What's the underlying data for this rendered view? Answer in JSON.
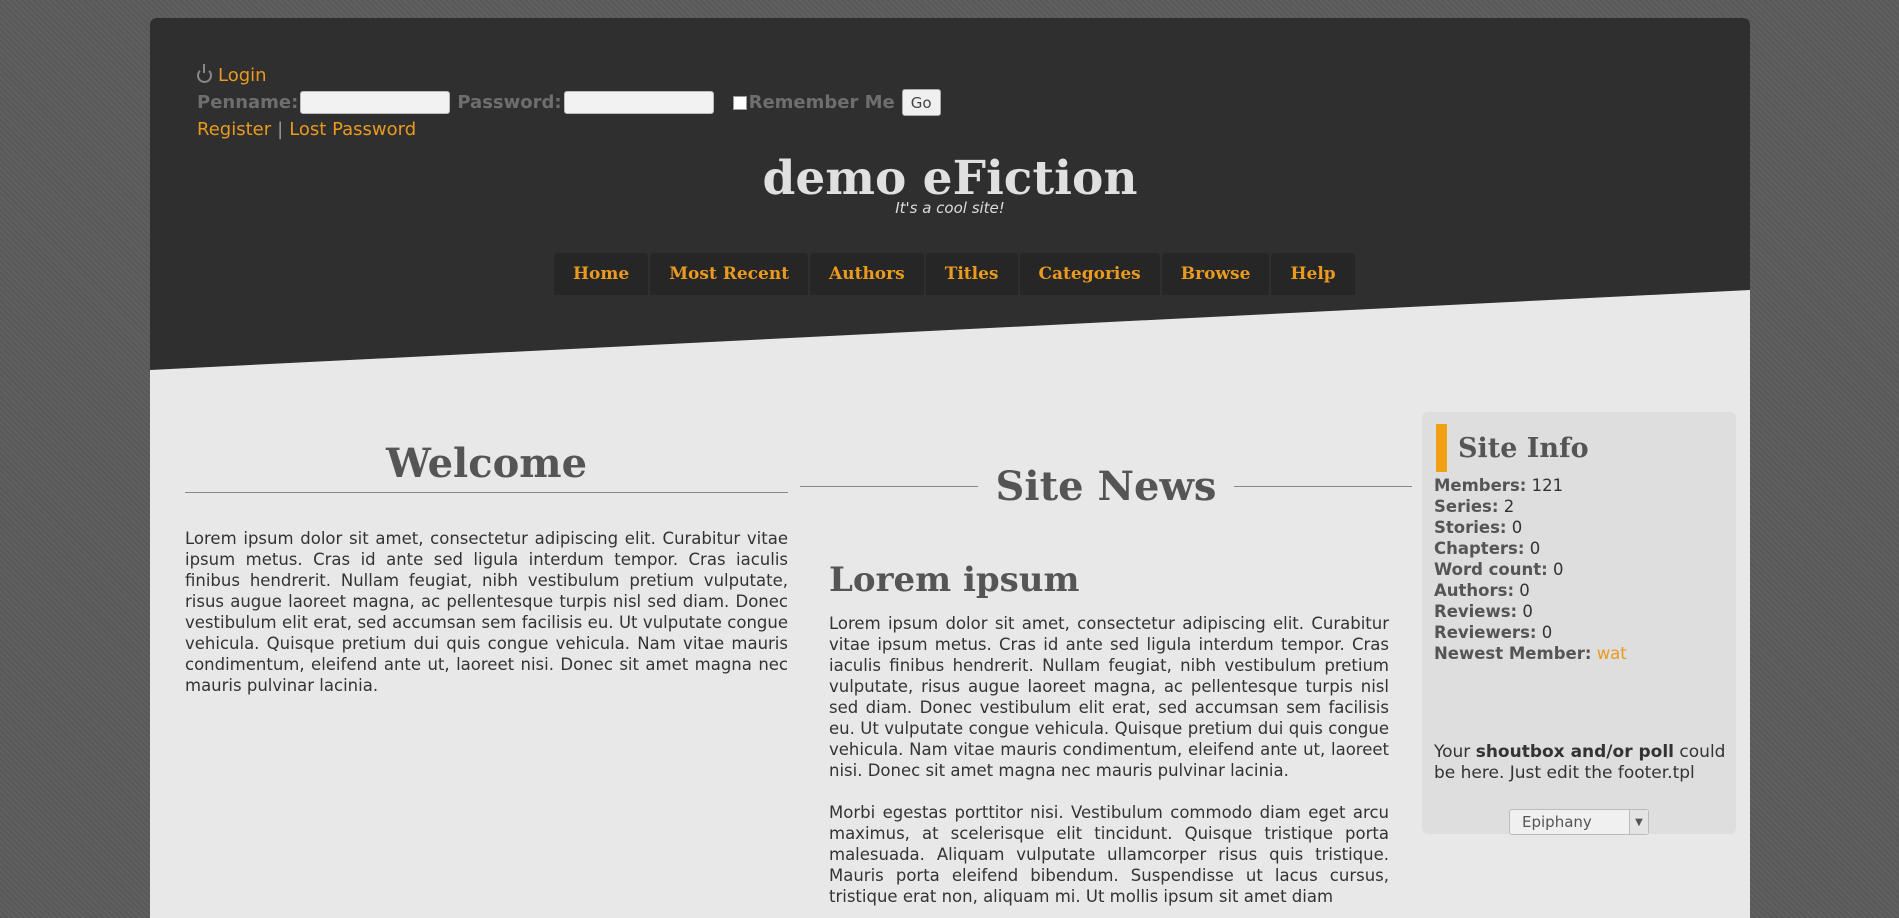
{
  "login": {
    "login_link": "Login",
    "penname_label": "Penname:",
    "password_label": "Password:",
    "remember_label": "Remember Me",
    "go_button": "Go",
    "register_link": "Register",
    "separator": "|",
    "lost_password_link": "Lost Password"
  },
  "site": {
    "title": "demo eFiction",
    "slogan": "It's a cool site!"
  },
  "nav": {
    "items": [
      "Home",
      "Most Recent",
      "Authors",
      "Titles",
      "Categories",
      "Browse",
      "Help"
    ]
  },
  "welcome": {
    "title": "Welcome",
    "text": "Lorem ipsum dolor sit amet, consectetur adipiscing elit. Curabitur vitae ipsum metus. Cras id ante sed ligula interdum tempor. Cras iaculis finibus hendrerit. Nullam feugiat, nibh vestibulum pretium vulputate, risus augue laoreet magna, ac pellentesque turpis nisl sed diam. Donec vestibulum elit erat, sed accumsan sem facilisis eu. Ut vulputate congue vehicula. Quisque pretium dui quis congue vehicula. Nam vitae mauris condimentum, eleifend ante ut, laoreet nisi. Donec sit amet magna nec mauris pulvinar lacinia."
  },
  "news": {
    "title": "Site News",
    "article_title": "Lorem ipsum",
    "paragraph1": "Lorem ipsum dolor sit amet, consectetur adipiscing elit. Curabitur vitae ipsum metus. Cras id ante sed ligula interdum tempor. Cras iaculis finibus hendrerit. Nullam feugiat, nibh vestibulum pretium vulputate, risus augue laoreet magna, ac pellentesque turpis nisl sed diam. Donec vestibulum elit erat, sed accumsan sem facilisis eu. Ut vulputate congue vehicula. Quisque pretium dui quis congue vehicula. Nam vitae mauris condimentum, eleifend ante ut, laoreet nisi. Donec sit amet magna nec mauris pulvinar lacinia.",
    "paragraph2": "Morbi egestas porttitor nisi. Vestibulum commodo diam eget arcu maximus, at scelerisque elit tincidunt. Quisque tristique porta malesuada. Aliquam vulputate ullamcorper risus quis tristique. Mauris porta eleifend bibendum. Suspendisse ut lacus cursus, tristique erat non, aliquam mi. Ut mollis ipsum sit amet diam"
  },
  "siteinfo": {
    "title": "Site Info",
    "stats": [
      {
        "label": "Members:",
        "value": "121"
      },
      {
        "label": "Series:",
        "value": "2"
      },
      {
        "label": "Stories:",
        "value": "0"
      },
      {
        "label": "Chapters:",
        "value": "0"
      },
      {
        "label": "Word count:",
        "value": "0"
      },
      {
        "label": "Authors:",
        "value": "0"
      },
      {
        "label": "Reviews:",
        "value": "0"
      },
      {
        "label": "Reviewers:",
        "value": "0"
      }
    ],
    "newest_label": "Newest Member:",
    "newest_value": "wat",
    "shout_pre": "Your",
    "shout_bold": "shoutbox and/or poll",
    "shout_post": "could be here. Just edit the footer.tpl",
    "skin_selected": "Epiphany"
  },
  "colors": {
    "accent": "#e99a1f",
    "header_bg": "#2f2f2f",
    "content_bg": "#e8e8e8",
    "sidebar_bar": "#f1a015"
  }
}
